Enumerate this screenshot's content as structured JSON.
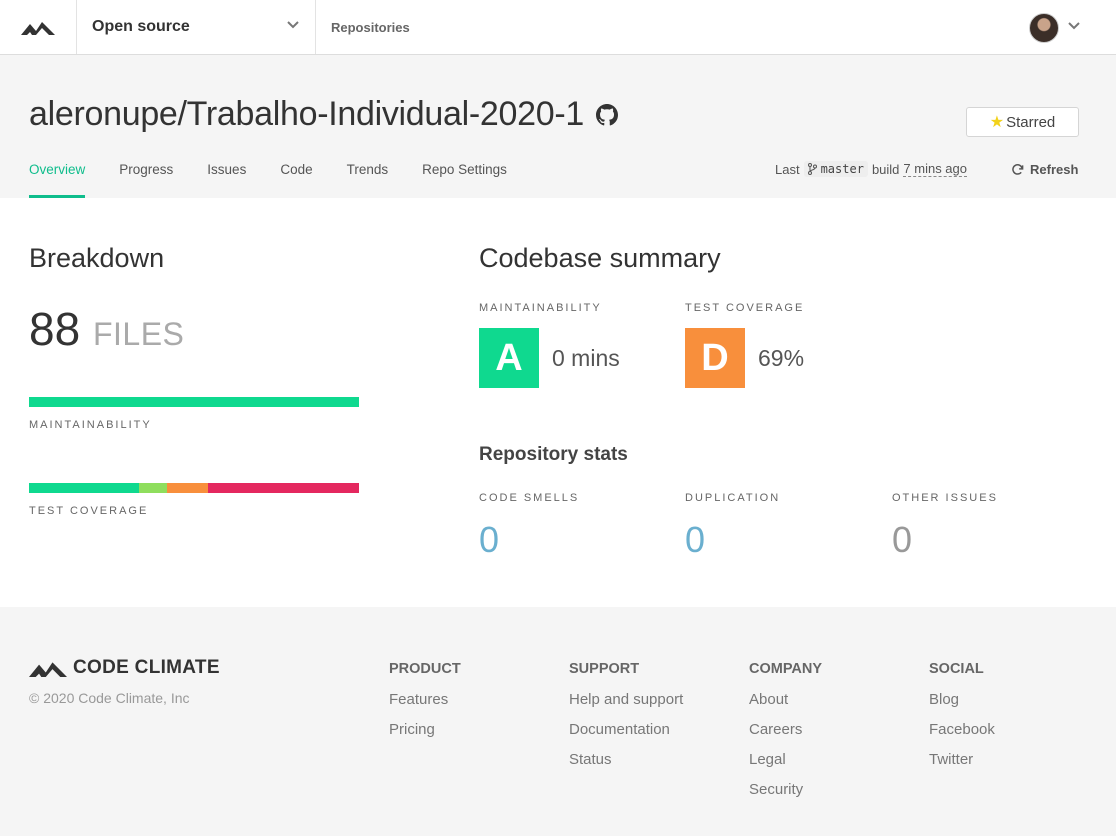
{
  "nav": {
    "org": "Open source",
    "repositories": "Repositories"
  },
  "header": {
    "repo_title": "aleronupe/Trabalho-Individual-2020-1",
    "starred_label": "Starred",
    "tabs": [
      {
        "label": "Overview",
        "active": true
      },
      {
        "label": "Progress"
      },
      {
        "label": "Issues"
      },
      {
        "label": "Code"
      },
      {
        "label": "Trends"
      },
      {
        "label": "Repo Settings"
      }
    ],
    "build": {
      "prefix": "Last",
      "branch": "master",
      "middle": "build",
      "time": "7 mins ago"
    },
    "refresh_label": "Refresh"
  },
  "breakdown": {
    "title": "Breakdown",
    "files_count": "88",
    "files_unit": "FILES",
    "maintainability_label": "MAINTAINABILITY",
    "test_coverage_label": "TEST COVERAGE",
    "maintainability_bar": [
      {
        "fraction": 1.0,
        "color": "#0fd98f"
      }
    ],
    "coverage_bar": [
      {
        "fraction": 0.333,
        "color": "#0fd98f"
      },
      {
        "fraction": 0.085,
        "color": "#8fde5d"
      },
      {
        "fraction": 0.124,
        "color": "#f88f3c"
      },
      {
        "fraction": 0.458,
        "color": "#e4285f"
      }
    ]
  },
  "summary": {
    "title": "Codebase summary",
    "maintainability": {
      "label": "MAINTAINABILITY",
      "grade": "A",
      "value": "0 mins",
      "color": "#0fd98f"
    },
    "test_coverage": {
      "label": "TEST COVERAGE",
      "grade": "D",
      "value": "69%",
      "color": "#f88f3c"
    },
    "stats_title": "Repository stats",
    "stats": [
      {
        "label": "CODE SMELLS",
        "value": "0",
        "color": "#6aafcf"
      },
      {
        "label": "DUPLICATION",
        "value": "0",
        "color": "#6aafcf"
      },
      {
        "label": "OTHER ISSUES",
        "value": "0",
        "color": "#999999"
      }
    ]
  },
  "footer": {
    "brand": "CODE CLIMATE",
    "copyright": "© 2020 Code Climate, Inc",
    "columns": [
      {
        "heading": "PRODUCT",
        "links": [
          "Features",
          "Pricing"
        ]
      },
      {
        "heading": "SUPPORT",
        "links": [
          "Help and support",
          "Documentation",
          "Status"
        ]
      },
      {
        "heading": "COMPANY",
        "links": [
          "About",
          "Careers",
          "Legal",
          "Security"
        ]
      },
      {
        "heading": "SOCIAL",
        "links": [
          "Blog",
          "Facebook",
          "Twitter"
        ]
      }
    ]
  },
  "icons": {
    "logo": "code-climate-logo-icon",
    "github": "github-icon",
    "star": "star-icon",
    "branch": "git-branch-icon",
    "refresh": "refresh-icon",
    "chevron": "chevron-down-icon"
  }
}
